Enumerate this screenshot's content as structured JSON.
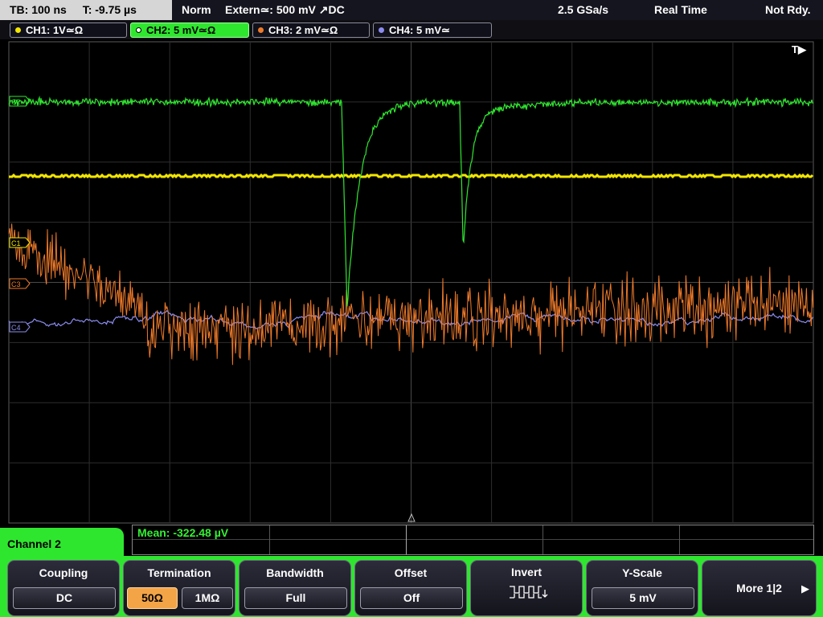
{
  "status_bar": {
    "timebase": "TB: 100 ns",
    "trigger_time": "T: -9.75 µs",
    "trigger_mode": "Norm",
    "trigger_source": "Extern≃: 500 mV ↗DC",
    "sample_rate": "2.5 GSa/s",
    "acq_mode": "Real Time",
    "status": "Not Rdy."
  },
  "channels": [
    {
      "label": "CH1: 1V≃Ω",
      "color": "#f2e600",
      "active": false
    },
    {
      "label": "CH2: 5 mV≃Ω",
      "color": "#2fe62f",
      "active": true
    },
    {
      "label": "CH3: 2 mV≃Ω",
      "color": "#ee7a2a",
      "active": false
    },
    {
      "label": "CH4: 5 mV≃",
      "color": "#8c8cf0",
      "active": false
    }
  ],
  "screen": {
    "trigger_marker": "T▶",
    "markers": [
      "C1",
      "C3",
      "C4",
      "C2"
    ]
  },
  "measurement": {
    "mean": "Mean: -322.48 µV"
  },
  "menu": {
    "title": "Channel 2",
    "coupling": {
      "title": "Coupling",
      "value": "DC"
    },
    "termination": {
      "title": "Termination",
      "opt1": "50Ω",
      "opt2": "1MΩ"
    },
    "bandwidth": {
      "title": "Bandwidth",
      "value": "Full"
    },
    "offset": {
      "title": "Offset",
      "value": "Off"
    },
    "invert": {
      "title": "Invert"
    },
    "yscale": {
      "title": "Y-Scale",
      "value": "5 mV"
    },
    "more": {
      "label": "More 1|2",
      "arrow": "▶"
    }
  }
}
